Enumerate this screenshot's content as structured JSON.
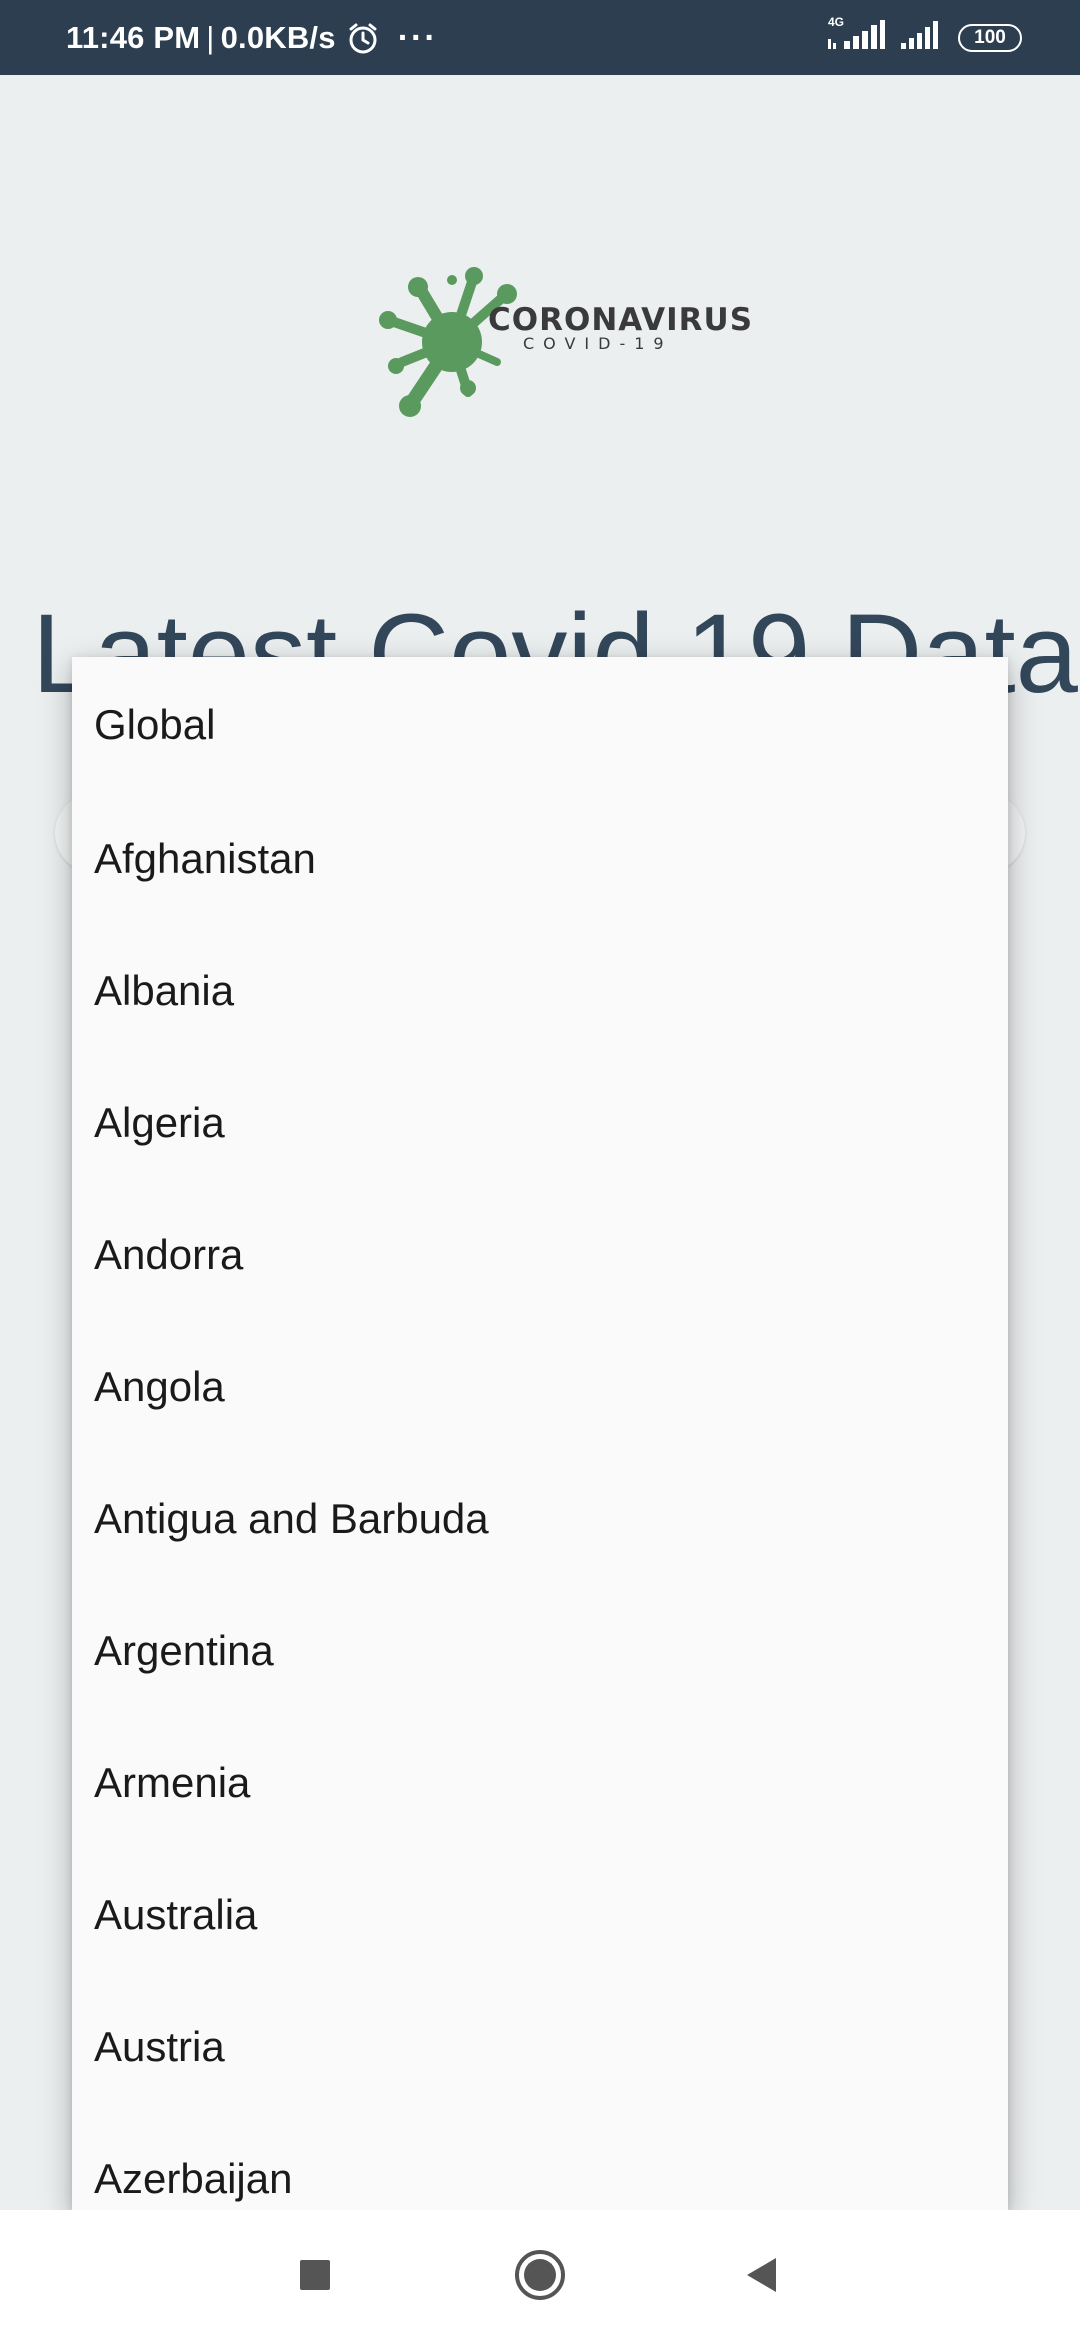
{
  "status_bar": {
    "time": "11:46 PM",
    "separator": "|",
    "net_speed": "0.0KB/s",
    "dots": "···",
    "network_tag": "4G",
    "battery": "100",
    "icons": [
      "alarm-icon",
      "signal-4g-icon",
      "signal-icon",
      "battery-icon"
    ]
  },
  "app": {
    "logo_title": "CORONAVIRUS",
    "logo_subtitle": "COVID-19",
    "headline": "Latest Covid 19 Data"
  },
  "dropdown": {
    "options": [
      "Global",
      "Afghanistan",
      "Albania",
      "Algeria",
      "Andorra",
      "Angola",
      "Antigua and Barbuda",
      "Argentina",
      "Armenia",
      "Australia",
      "Austria",
      "Azerbaijan"
    ]
  },
  "nav_bar": {
    "buttons": [
      "recents-icon",
      "home-icon",
      "back-icon"
    ]
  },
  "colors": {
    "status_bar": "#2C3E50",
    "background": "#ECEFF0",
    "headline": "#33475B",
    "logo_green": "#5A9A5E",
    "dropdown_bg": "#FAFAFA"
  }
}
